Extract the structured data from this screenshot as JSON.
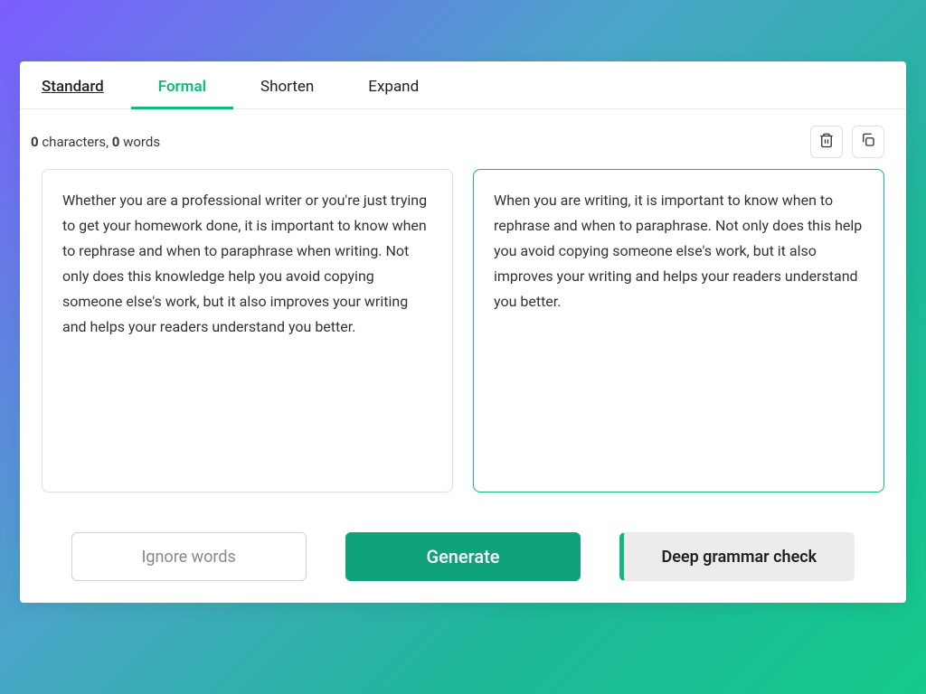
{
  "tabs": {
    "standard": "Standard",
    "formal": "Formal",
    "shorten": "Shorten",
    "expand": "Expand"
  },
  "counter": {
    "chars_value": "0",
    "chars_label": " characters,  ",
    "words_value": "0",
    "words_label": " words"
  },
  "input_text": "Whether you are a professional writer or you're just trying to get your homework done, it is important to know when to rephrase and when to paraphrase when writing. Not only does this knowledge help you avoid copying someone else's work, but it also improves your writing and helps your readers understand you better.",
  "output_text": "When you are writing, it is important to know when to rephrase and when to paraphrase. Not only does this help you avoid copying someone else's work, but it also improves your writing and helps your readers understand you better.",
  "buttons": {
    "ignore": "Ignore words",
    "generate": "Generate",
    "grammar": "Deep grammar check"
  }
}
